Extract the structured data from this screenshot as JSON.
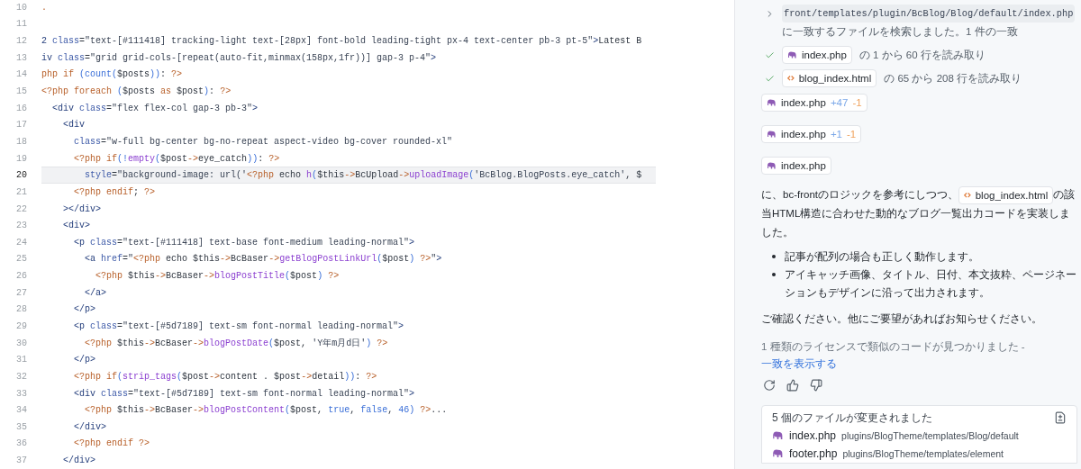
{
  "editor": {
    "lines": [
      {
        "number": "10",
        "current": false,
        "tokens": [
          {
            "kind": "php",
            "text": "."
          }
        ]
      },
      {
        "number": "11",
        "current": false
      },
      {
        "number": "12",
        "current": false,
        "tokens": [
          {
            "kind": "tag",
            "text": "2"
          },
          {
            "kind": "attr",
            "text": " class"
          },
          {
            "kind": "text",
            "text": "="
          },
          {
            "kind": "str",
            "text": "\"text-[#111418] tracking-light text-[28px] font-bold leading-tight px-4 text-center pb-3 pt-5\""
          },
          {
            "kind": "tag",
            "text": ">"
          },
          {
            "kind": "text",
            "text": "Latest B"
          }
        ]
      },
      {
        "number": "13",
        "current": false,
        "tokens": [
          {
            "kind": "tag",
            "text": "iv"
          },
          {
            "kind": "attr",
            "text": " class"
          },
          {
            "kind": "text",
            "text": "="
          },
          {
            "kind": "str",
            "text": "\"grid grid-cols-[repeat(auto-fit,minmax(158px,1fr))] gap-3 p-4\""
          },
          {
            "kind": "tag",
            "text": ">"
          }
        ]
      },
      {
        "number": "14",
        "current": false,
        "tokens": [
          {
            "kind": "php",
            "text": "php"
          },
          {
            "kind": "php",
            "text": " if"
          },
          {
            "kind": "punc",
            "text": " (count("
          },
          {
            "kind": "text",
            "text": "$posts"
          },
          {
            "kind": "punc",
            "text": "))"
          },
          {
            "kind": "text",
            "text": ":"
          },
          {
            "kind": "php",
            "text": " ?>"
          }
        ]
      },
      {
        "number": "15",
        "current": false,
        "tokens": [
          {
            "kind": "php",
            "text": "<?php"
          },
          {
            "kind": "php",
            "text": " foreach"
          },
          {
            "kind": "punc",
            "text": " ("
          },
          {
            "kind": "text",
            "text": "$posts "
          },
          {
            "kind": "php",
            "text": "as"
          },
          {
            "kind": "text",
            "text": " $post"
          },
          {
            "kind": "punc",
            "text": ")"
          },
          {
            "kind": "text",
            "text": ":"
          },
          {
            "kind": "php",
            "text": " ?>"
          }
        ]
      },
      {
        "number": "16",
        "current": false,
        "tokens": [
          {
            "kind": "tag",
            "text": "  <div"
          },
          {
            "kind": "attr",
            "text": " class"
          },
          {
            "kind": "text",
            "text": "="
          },
          {
            "kind": "str",
            "text": "\"flex flex-col gap-3 pb-3\""
          },
          {
            "kind": "tag",
            "text": ">"
          }
        ]
      },
      {
        "number": "17",
        "current": false,
        "tokens": [
          {
            "kind": "tag",
            "text": "    <div"
          }
        ]
      },
      {
        "number": "18",
        "current": false,
        "tokens": [
          {
            "kind": "attr",
            "text": "      class"
          },
          {
            "kind": "text",
            "text": "="
          },
          {
            "kind": "str",
            "text": "\"w-full bg-center bg-no-repeat aspect-video bg-cover rounded-xl\""
          }
        ]
      },
      {
        "number": "19",
        "current": false,
        "tokens": [
          {
            "kind": "php",
            "text": "      <?php"
          },
          {
            "kind": "php",
            "text": " if"
          },
          {
            "kind": "punc",
            "text": "(!"
          },
          {
            "kind": "fn",
            "text": "empty"
          },
          {
            "kind": "punc",
            "text": "("
          },
          {
            "kind": "text",
            "text": "$post"
          },
          {
            "kind": "php",
            "text": "->"
          },
          {
            "kind": "text",
            "text": "eye_catch"
          },
          {
            "kind": "punc",
            "text": "))"
          },
          {
            "kind": "text",
            "text": ":"
          },
          {
            "kind": "php",
            "text": " ?>"
          }
        ]
      },
      {
        "number": "20",
        "current": true,
        "tokens": [
          {
            "kind": "attr",
            "text": "        style"
          },
          {
            "kind": "text",
            "text": "="
          },
          {
            "kind": "str",
            "text": "\"background-image: url('"
          },
          {
            "kind": "php",
            "text": "<?php"
          },
          {
            "kind": "text",
            "text": " echo "
          },
          {
            "kind": "fn",
            "text": "h"
          },
          {
            "kind": "punc",
            "text": "("
          },
          {
            "kind": "text",
            "text": "$this"
          },
          {
            "kind": "php",
            "text": "->"
          },
          {
            "kind": "text",
            "text": "BcUpload"
          },
          {
            "kind": "php",
            "text": "->"
          },
          {
            "kind": "fn",
            "text": "uploadImage"
          },
          {
            "kind": "punc",
            "text": "("
          },
          {
            "kind": "str",
            "text": "'BcBlog.BlogPosts.eye_catch'"
          },
          {
            "kind": "text",
            "text": ", $"
          }
        ]
      },
      {
        "number": "21",
        "current": false,
        "tokens": [
          {
            "kind": "php",
            "text": "      <?php"
          },
          {
            "kind": "php",
            "text": " endif"
          },
          {
            "kind": "text",
            "text": ";"
          },
          {
            "kind": "php",
            "text": " ?>"
          }
        ]
      },
      {
        "number": "22",
        "current": false,
        "tokens": [
          {
            "kind": "tag",
            "text": "    ></div>"
          }
        ]
      },
      {
        "number": "23",
        "current": false,
        "tokens": [
          {
            "kind": "tag",
            "text": "    <div>"
          }
        ]
      },
      {
        "number": "24",
        "current": false,
        "tokens": [
          {
            "kind": "tag",
            "text": "      <p"
          },
          {
            "kind": "attr",
            "text": " class"
          },
          {
            "kind": "text",
            "text": "="
          },
          {
            "kind": "str",
            "text": "\"text-[#111418] text-base font-medium leading-normal\""
          },
          {
            "kind": "tag",
            "text": ">"
          }
        ]
      },
      {
        "number": "25",
        "current": false,
        "tokens": [
          {
            "kind": "tag",
            "text": "        <a"
          },
          {
            "kind": "attr",
            "text": " href"
          },
          {
            "kind": "text",
            "text": "="
          },
          {
            "kind": "str",
            "text": "\""
          },
          {
            "kind": "php",
            "text": "<?php"
          },
          {
            "kind": "text",
            "text": " echo $this"
          },
          {
            "kind": "php",
            "text": "->"
          },
          {
            "kind": "text",
            "text": "BcBaser"
          },
          {
            "kind": "php",
            "text": "->"
          },
          {
            "kind": "fn",
            "text": "getBlogPostLinkUrl"
          },
          {
            "kind": "punc",
            "text": "("
          },
          {
            "kind": "text",
            "text": "$post"
          },
          {
            "kind": "punc",
            "text": ")"
          },
          {
            "kind": "php",
            "text": " ?>"
          },
          {
            "kind": "str",
            "text": "\""
          },
          {
            "kind": "tag",
            "text": ">"
          }
        ]
      },
      {
        "number": "26",
        "current": false,
        "tokens": [
          {
            "kind": "php",
            "text": "          <?php"
          },
          {
            "kind": "text",
            "text": " $this"
          },
          {
            "kind": "php",
            "text": "->"
          },
          {
            "kind": "text",
            "text": "BcBaser"
          },
          {
            "kind": "php",
            "text": "->"
          },
          {
            "kind": "fn",
            "text": "blogPostTitle"
          },
          {
            "kind": "punc",
            "text": "("
          },
          {
            "kind": "text",
            "text": "$post"
          },
          {
            "kind": "punc",
            "text": ")"
          },
          {
            "kind": "php",
            "text": " ?>"
          }
        ]
      },
      {
        "number": "27",
        "current": false,
        "tokens": [
          {
            "kind": "tag",
            "text": "        </a>"
          }
        ]
      },
      {
        "number": "28",
        "current": false,
        "tokens": [
          {
            "kind": "tag",
            "text": "      </p>"
          }
        ]
      },
      {
        "number": "29",
        "current": false,
        "tokens": [
          {
            "kind": "tag",
            "text": "      <p"
          },
          {
            "kind": "attr",
            "text": " class"
          },
          {
            "kind": "text",
            "text": "="
          },
          {
            "kind": "str",
            "text": "\"text-[#5d7189] text-sm font-normal leading-normal\""
          },
          {
            "kind": "tag",
            "text": ">"
          }
        ]
      },
      {
        "number": "30",
        "current": false,
        "tokens": [
          {
            "kind": "php",
            "text": "        <?php"
          },
          {
            "kind": "text",
            "text": " $this"
          },
          {
            "kind": "php",
            "text": "->"
          },
          {
            "kind": "text",
            "text": "BcBaser"
          },
          {
            "kind": "php",
            "text": "->"
          },
          {
            "kind": "fn",
            "text": "blogPostDate"
          },
          {
            "kind": "punc",
            "text": "("
          },
          {
            "kind": "text",
            "text": "$post, "
          },
          {
            "kind": "str",
            "text": "'Y年m月d日'"
          },
          {
            "kind": "punc",
            "text": ")"
          },
          {
            "kind": "php",
            "text": " ?>"
          }
        ]
      },
      {
        "number": "31",
        "current": false,
        "tokens": [
          {
            "kind": "tag",
            "text": "      </p>"
          }
        ]
      },
      {
        "number": "32",
        "current": false,
        "tokens": [
          {
            "kind": "php",
            "text": "      <?php"
          },
          {
            "kind": "php",
            "text": " if"
          },
          {
            "kind": "punc",
            "text": "("
          },
          {
            "kind": "fn",
            "text": "strip_tags"
          },
          {
            "kind": "punc",
            "text": "("
          },
          {
            "kind": "text",
            "text": "$post"
          },
          {
            "kind": "php",
            "text": "->"
          },
          {
            "kind": "text",
            "text": "content . $post"
          },
          {
            "kind": "php",
            "text": "->"
          },
          {
            "kind": "text",
            "text": "detail"
          },
          {
            "kind": "punc",
            "text": "))"
          },
          {
            "kind": "text",
            "text": ":"
          },
          {
            "kind": "php",
            "text": " ?>"
          }
        ]
      },
      {
        "number": "33",
        "current": false,
        "tokens": [
          {
            "kind": "tag",
            "text": "      <div"
          },
          {
            "kind": "attr",
            "text": " class"
          },
          {
            "kind": "text",
            "text": "="
          },
          {
            "kind": "str",
            "text": "\"text-[#5d7189] text-sm font-normal leading-normal\""
          },
          {
            "kind": "tag",
            "text": ">"
          }
        ]
      },
      {
        "number": "34",
        "current": false,
        "tokens": [
          {
            "kind": "php",
            "text": "        <?php"
          },
          {
            "kind": "text",
            "text": " $this"
          },
          {
            "kind": "php",
            "text": "->"
          },
          {
            "kind": "text",
            "text": "BcBaser"
          },
          {
            "kind": "php",
            "text": "->"
          },
          {
            "kind": "fn",
            "text": "blogPostContent"
          },
          {
            "kind": "punc",
            "text": "("
          },
          {
            "kind": "text",
            "text": "$post,"
          },
          {
            "kind": "punc",
            "text": " true"
          },
          {
            "kind": "text",
            "text": ","
          },
          {
            "kind": "punc",
            "text": " false"
          },
          {
            "kind": "text",
            "text": ","
          },
          {
            "kind": "punc",
            "text": " 46)"
          },
          {
            "kind": "php",
            "text": " ?>"
          },
          {
            "kind": "text",
            "text": "..."
          }
        ]
      },
      {
        "number": "35",
        "current": false,
        "tokens": [
          {
            "kind": "tag",
            "text": "      </div>"
          }
        ]
      },
      {
        "number": "36",
        "current": false,
        "tokens": [
          {
            "kind": "php",
            "text": "      <?php"
          },
          {
            "kind": "php",
            "text": " endif"
          },
          {
            "kind": "php",
            "text": " ?>"
          }
        ]
      },
      {
        "number": "37",
        "current": false,
        "tokens": [
          {
            "kind": "tag",
            "text": "    </div>"
          }
        ]
      }
    ]
  },
  "chat": {
    "steps": [
      {
        "kind": "search",
        "path": "front/templates/plugin/BcBlog/Blog/default/index.php",
        "text": "に一致するファイルを検索しました。1 件の一致"
      },
      {
        "kind": "read",
        "file": {
          "name": "index.php",
          "kind": "php"
        },
        "text": "の 1 から 60 行を読み取り"
      },
      {
        "kind": "read",
        "file": {
          "name": "blog_index.html",
          "kind": "html"
        },
        "text": "の 65 から 208 行を読み取り"
      }
    ],
    "edits": [
      {
        "file": {
          "name": "index.php",
          "kind": "php"
        },
        "added": "+47",
        "removed": "-1"
      },
      {
        "file": {
          "name": "index.php",
          "kind": "php"
        },
        "added": "+1",
        "removed": "-1"
      },
      {
        "file": {
          "name": "index.php",
          "kind": "php"
        }
      }
    ],
    "summary": {
      "before": "に、bc-frontのロジックを参考にしつつ、",
      "file": {
        "name": "blog_index.html",
        "kind": "html"
      },
      "after": "の該当HTML構造に合わせた動的なブログ一覧出力コードを実装しました。"
    },
    "bullets": [
      "記事が配列の場合も正しく動作します。",
      "アイキャッチ画像、タイトル、日付、本文抜粋、ページネーションもデザインに沿って出力されます。"
    ],
    "closing": "ご確認ください。他にご要望があればお知らせください。",
    "license": {
      "text": "1 種類のライセンスで類似のコードが見つかりました - ",
      "link": "一致を表示する"
    },
    "changes": {
      "title": "5 個のファイルが変更されました",
      "files": [
        {
          "name": "index.php",
          "path": "plugins/BlogTheme/templates/Blog/default",
          "kind": "php"
        },
        {
          "name": "footer.php",
          "path": "plugins/BlogTheme/templates/element",
          "kind": "php"
        }
      ]
    }
  }
}
